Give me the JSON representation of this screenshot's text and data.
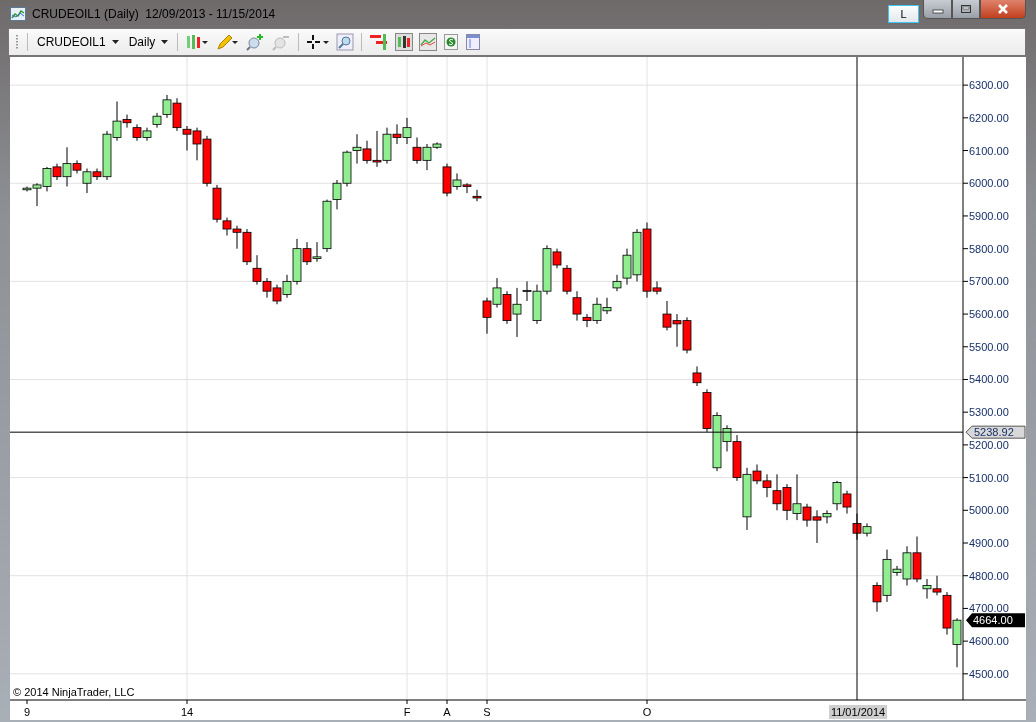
{
  "window": {
    "title": "CRUDEOIL1 (Daily)  12/09/2013 - 11/15/2014",
    "mode_button": "L"
  },
  "toolbar": {
    "instrument": "CRUDEOIL1",
    "period": "Daily"
  },
  "chart": {
    "copyright": "© 2014 NinjaTrader, LLC",
    "time_axis_labels": [
      "9",
      "14",
      "F",
      "A",
      "S",
      "O"
    ],
    "crosshair": {
      "date_label": "11/01/2014"
    },
    "last_price_label": "4664.00",
    "chart_data": {
      "type": "candlestick",
      "ylim": [
        4420,
        6386
      ],
      "grid": true,
      "ref_lines": [
        {
          "axis": "y",
          "value": 5238.92,
          "label": "5238.92"
        }
      ],
      "yticks": [
        {
          "value": 6300,
          "label": "6300.00"
        },
        {
          "value": 6200,
          "label": "6200.00"
        },
        {
          "value": 6100,
          "label": "6100.00"
        },
        {
          "value": 6000,
          "label": "6000.00"
        },
        {
          "value": 5900,
          "label": "5900.00"
        },
        {
          "value": 5800,
          "label": "5800.00"
        },
        {
          "value": 5700,
          "label": "5700.00"
        },
        {
          "value": 5600,
          "label": "5600.00"
        },
        {
          "value": 5500,
          "label": "5500.00"
        },
        {
          "value": 5400,
          "label": "5400.00"
        },
        {
          "value": 5300,
          "label": "5300.00"
        },
        {
          "value": 5200,
          "label": "5200.00"
        },
        {
          "value": 5100,
          "label": "5100.00"
        },
        {
          "value": 5000,
          "label": "5000.00"
        },
        {
          "value": 4900,
          "label": "4900.00"
        },
        {
          "value": 4800,
          "label": "4800.00"
        },
        {
          "value": 4700,
          "label": "4700.00"
        },
        {
          "value": 4600,
          "label": "4600.00"
        },
        {
          "value": 4500,
          "label": "4500.00"
        }
      ],
      "ohlc": [
        [
          5980,
          5990,
          5975,
          5985
        ],
        [
          5985,
          6000,
          5930,
          5995
        ],
        [
          5990,
          6050,
          5975,
          6045
        ],
        [
          6050,
          6060,
          6010,
          6020
        ],
        [
          6020,
          6110,
          5990,
          6060
        ],
        [
          6060,
          6070,
          6030,
          6040
        ],
        [
          6000,
          6045,
          5970,
          6035
        ],
        [
          6035,
          6045,
          6010,
          6020
        ],
        [
          6020,
          6160,
          6010,
          6150
        ],
        [
          6140,
          6250,
          6130,
          6190
        ],
        [
          6195,
          6210,
          6170,
          6185
        ],
        [
          6170,
          6180,
          6130,
          6140
        ],
        [
          6140,
          6170,
          6130,
          6160
        ],
        [
          6180,
          6215,
          6170,
          6205
        ],
        [
          6210,
          6270,
          6200,
          6255
        ],
        [
          6245,
          6260,
          6160,
          6170
        ],
        [
          6165,
          6175,
          6100,
          6150
        ],
        [
          6160,
          6170,
          6070,
          6120
        ],
        [
          6135,
          6145,
          5990,
          6000
        ],
        [
          5985,
          5995,
          5880,
          5890
        ],
        [
          5885,
          5895,
          5840,
          5860
        ],
        [
          5860,
          5870,
          5800,
          5850
        ],
        [
          5850,
          5860,
          5750,
          5760
        ],
        [
          5740,
          5780,
          5690,
          5700
        ],
        [
          5700,
          5710,
          5650,
          5670
        ],
        [
          5680,
          5690,
          5630,
          5640
        ],
        [
          5660,
          5720,
          5650,
          5700
        ],
        [
          5700,
          5830,
          5690,
          5800
        ],
        [
          5800,
          5820,
          5750,
          5760
        ],
        [
          5770,
          5820,
          5760,
          5775
        ],
        [
          5800,
          5950,
          5790,
          5945
        ],
        [
          5950,
          6010,
          5920,
          6000
        ],
        [
          6000,
          6100,
          5990,
          6095
        ],
        [
          6100,
          6150,
          6060,
          6110
        ],
        [
          6105,
          6130,
          6060,
          6070
        ],
        [
          6070,
          6160,
          6050,
          6065
        ],
        [
          6070,
          6170,
          6060,
          6150
        ],
        [
          6150,
          6180,
          6120,
          6140
        ],
        [
          6140,
          6200,
          6120,
          6170
        ],
        [
          6110,
          6140,
          6060,
          6070
        ],
        [
          6070,
          6120,
          6040,
          6110
        ],
        [
          6110,
          6125,
          6105,
          6120
        ],
        [
          6050,
          6060,
          5960,
          5970
        ],
        [
          5990,
          6030,
          5980,
          6010
        ],
        [
          5995,
          6000,
          5970,
          5990
        ],
        [
          5960,
          5980,
          5945,
          5955
        ],
        [
          5640,
          5650,
          5540,
          5590
        ],
        [
          5630,
          5710,
          5620,
          5680
        ],
        [
          5660,
          5670,
          5570,
          5580
        ],
        [
          5600,
          5680,
          5530,
          5630
        ],
        [
          5670,
          5700,
          5640,
          5672
        ],
        [
          5580,
          5690,
          5570,
          5670
        ],
        [
          5670,
          5810,
          5660,
          5800
        ],
        [
          5790,
          5800,
          5740,
          5750
        ],
        [
          5740,
          5750,
          5660,
          5670
        ],
        [
          5650,
          5670,
          5580,
          5600
        ],
        [
          5590,
          5600,
          5560,
          5580
        ],
        [
          5580,
          5650,
          5570,
          5630
        ],
        [
          5610,
          5650,
          5600,
          5620
        ],
        [
          5680,
          5720,
          5670,
          5700
        ],
        [
          5710,
          5800,
          5690,
          5780
        ],
        [
          5720,
          5860,
          5700,
          5850
        ],
        [
          5860,
          5880,
          5650,
          5670
        ],
        [
          5680,
          5700,
          5660,
          5670
        ],
        [
          5600,
          5640,
          5550,
          5560
        ],
        [
          5580,
          5600,
          5500,
          5570
        ],
        [
          5580,
          5590,
          5480,
          5490
        ],
        [
          5420,
          5440,
          5380,
          5390
        ],
        [
          5360,
          5370,
          5240,
          5250
        ],
        [
          5130,
          5300,
          5120,
          5290
        ],
        [
          5210,
          5260,
          5180,
          5250
        ],
        [
          5210,
          5230,
          5090,
          5100
        ],
        [
          4980,
          5130,
          4940,
          5110
        ],
        [
          5120,
          5140,
          5080,
          5090
        ],
        [
          5090,
          5110,
          5040,
          5070
        ],
        [
          5060,
          5110,
          5000,
          5020
        ],
        [
          5070,
          5080,
          4970,
          5000
        ],
        [
          4990,
          5110,
          4970,
          5020
        ],
        [
          5010,
          5020,
          4950,
          4970
        ],
        [
          4980,
          5000,
          4900,
          4970
        ],
        [
          4980,
          5000,
          4960,
          4990
        ],
        [
          5020,
          5090,
          5000,
          5085
        ],
        [
          5050,
          5060,
          4990,
          5010
        ],
        [
          4960,
          4990,
          4910,
          4930
        ],
        [
          4930,
          4960,
          4920,
          4950
        ],
        [
          4770,
          4780,
          4690,
          4720
        ],
        [
          4740,
          4880,
          4720,
          4850
        ],
        [
          4810,
          4830,
          4800,
          4820
        ],
        [
          4790,
          4890,
          4770,
          4870
        ],
        [
          4870,
          4920,
          4780,
          4790
        ],
        [
          4760,
          4790,
          4730,
          4770
        ],
        [
          4760,
          4800,
          4740,
          4750
        ],
        [
          4740,
          4750,
          4620,
          4640
        ],
        [
          4590,
          4670,
          4520,
          4664
        ]
      ]
    }
  }
}
